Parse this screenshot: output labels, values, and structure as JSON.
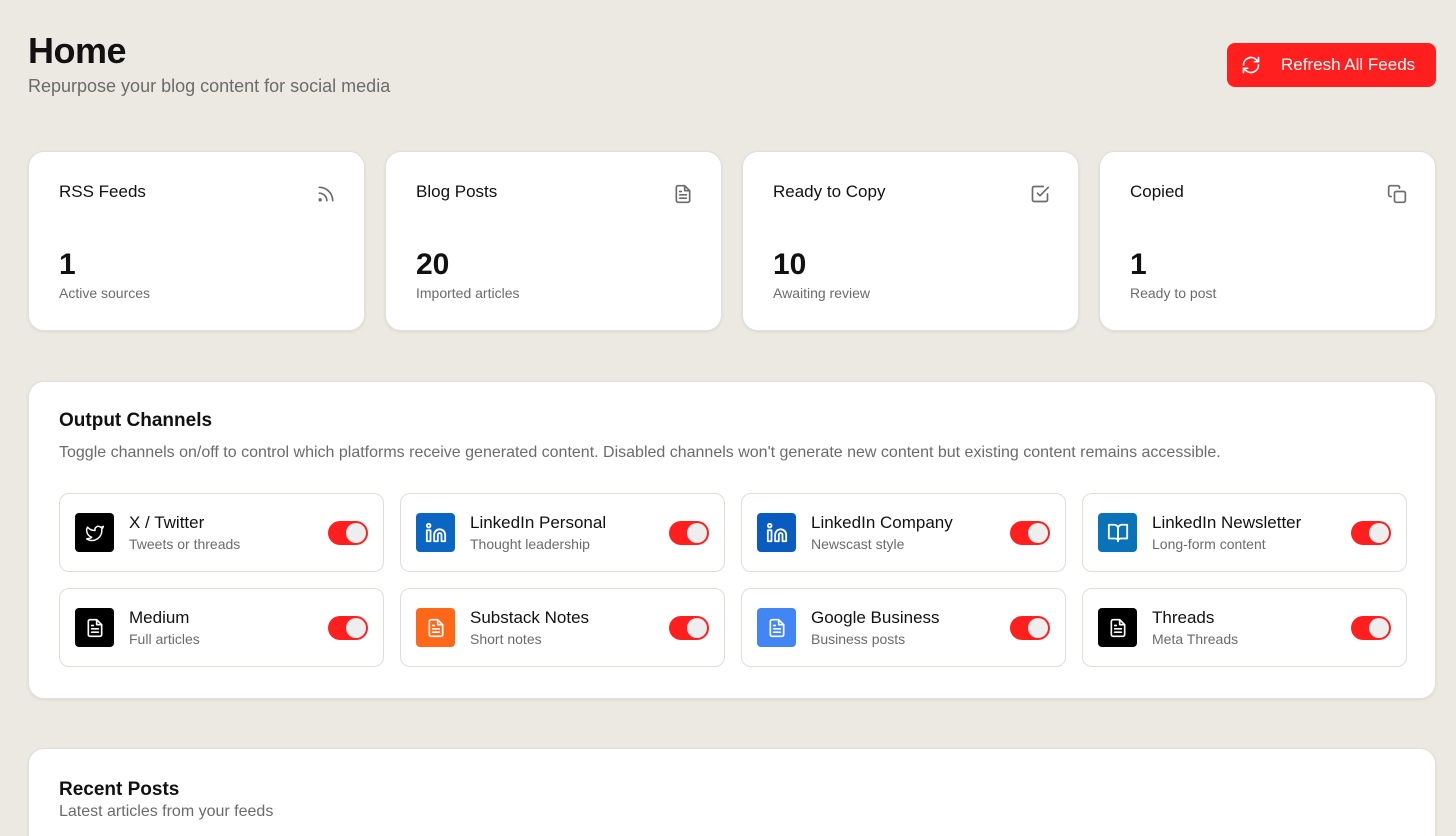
{
  "header": {
    "title": "Home",
    "subtitle": "Repurpose your blog content for social media",
    "refresh_label": "Refresh All Feeds"
  },
  "stats": [
    {
      "label": "RSS Feeds",
      "value": "1",
      "desc": "Active sources",
      "icon": "rss-icon"
    },
    {
      "label": "Blog Posts",
      "value": "20",
      "desc": "Imported articles",
      "icon": "document-icon"
    },
    {
      "label": "Ready to Copy",
      "value": "10",
      "desc": "Awaiting review",
      "icon": "checkbox-icon"
    },
    {
      "label": "Copied",
      "value": "1",
      "desc": "Ready to post",
      "icon": "copy-icon"
    }
  ],
  "channels_section": {
    "title": "Output Channels",
    "description": "Toggle channels on/off to control which platforms receive generated content. Disabled channels won't generate new content but existing content remains accessible.",
    "channels": [
      {
        "name": "X / Twitter",
        "desc": "Tweets or threads",
        "icon": "twitter-bird-icon",
        "color": "#000000",
        "enabled": true
      },
      {
        "name": "LinkedIn Personal",
        "desc": "Thought leadership",
        "icon": "linkedin-icon",
        "color": "#0A66C2",
        "enabled": true
      },
      {
        "name": "LinkedIn Company",
        "desc": "Newscast style",
        "icon": "linkedin-icon",
        "color": "#0A5BC0",
        "enabled": true
      },
      {
        "name": "LinkedIn Newsletter",
        "desc": "Long-form content",
        "icon": "book-open-icon",
        "color": "#0A72B8",
        "enabled": true
      },
      {
        "name": "Medium",
        "desc": "Full articles",
        "icon": "document-icon",
        "color": "#000000",
        "enabled": true
      },
      {
        "name": "Substack Notes",
        "desc": "Short notes",
        "icon": "document-icon",
        "color": "#FF6719",
        "enabled": true
      },
      {
        "name": "Google Business",
        "desc": "Business posts",
        "icon": "document-icon",
        "color": "#4285F4",
        "enabled": true
      },
      {
        "name": "Threads",
        "desc": "Meta Threads",
        "icon": "document-icon",
        "color": "#000000",
        "enabled": true
      }
    ]
  },
  "recent": {
    "title": "Recent Posts",
    "subtitle": "Latest articles from your feeds"
  },
  "colors": {
    "accent": "#FF1F1F",
    "background": "#ECE9E2"
  }
}
